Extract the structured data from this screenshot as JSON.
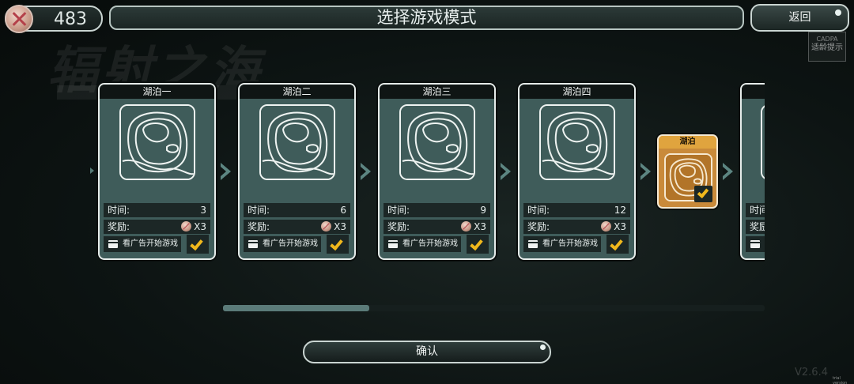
{
  "background": {
    "watermark_title": "辐射之海",
    "rating_label": "CADPA",
    "rating_hint": "适龄提示"
  },
  "header": {
    "coins": "483",
    "coin_icon": "coin-icon",
    "title": "选择游戏模式",
    "back_label": "返回"
  },
  "cards": [
    {
      "title": "湖泊一",
      "time_label": "时间:",
      "time": "3",
      "reward_label": "奖励:",
      "reward": "X3",
      "ad_label": "看广告开始游戏"
    },
    {
      "title": "湖泊二",
      "time_label": "时间:",
      "time": "6",
      "reward_label": "奖励:",
      "reward": "X3",
      "ad_label": "看广告开始游戏"
    },
    {
      "title": "湖泊三",
      "time_label": "时间:",
      "time": "9",
      "reward_label": "奖励:",
      "reward": "X3",
      "ad_label": "看广告开始游戏"
    },
    {
      "title": "湖泊四",
      "time_label": "时间:",
      "time": "12",
      "reward_label": "奖励:",
      "reward": "X3",
      "ad_label": "看广告开始游戏"
    }
  ],
  "partial_card": {
    "time_label": "时间",
    "reward_label": "奖励"
  },
  "selected_card": {
    "title": "湖泊"
  },
  "scroll": {
    "thumb_fraction": 0.27
  },
  "footer": {
    "confirm_label": "确认",
    "version": "V2.6.4",
    "corner_note": "trial version"
  },
  "colors": {
    "accent": "#f0b81c",
    "card": "#3f5c5a",
    "selected": "#c98a3a"
  }
}
